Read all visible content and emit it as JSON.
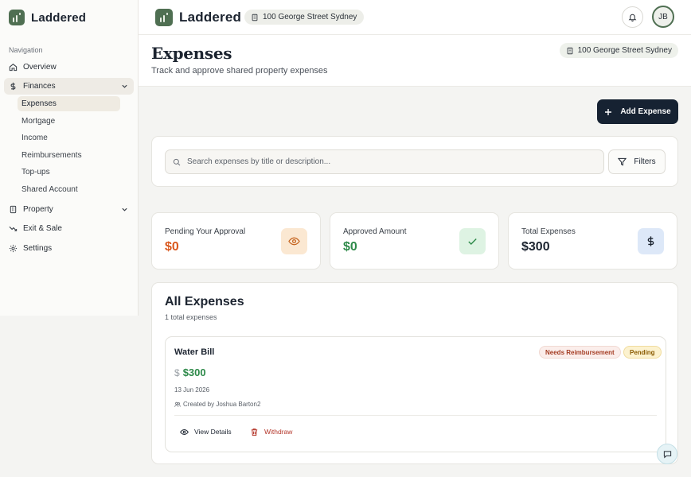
{
  "app": {
    "name": "Laddered"
  },
  "sidebar": {
    "caption": "Navigation",
    "items": [
      {
        "label": "Overview",
        "icon": "home-icon"
      },
      {
        "label": "Finances",
        "icon": "dollar-icon",
        "expanded": true
      },
      {
        "label": "Property",
        "icon": "building-icon"
      },
      {
        "label": "Exit & Sale",
        "icon": "trend-down-icon"
      },
      {
        "label": "Settings",
        "icon": "gear-icon"
      }
    ],
    "finance_subitems": [
      "Expenses",
      "Mortgage",
      "Income",
      "Reimbursements",
      "Top-ups",
      "Shared Account"
    ],
    "active_subitem": "Expenses"
  },
  "header": {
    "address": "100 George Street Sydney",
    "avatar_initials": "JB"
  },
  "page": {
    "title": "Expenses",
    "subtitle": "Track and approve shared property expenses",
    "address_badge": "100 George Street Sydney",
    "add_button": "Add Expense"
  },
  "search": {
    "placeholder": "Search expenses by title or description...",
    "filters_label": "Filters"
  },
  "stats": [
    {
      "label": "Pending Your Approval",
      "value": "$0",
      "color": "#d9581e",
      "icon": "eye-icon",
      "icon_bg": "#fbe8d2"
    },
    {
      "label": "Approved Amount",
      "value": "$0",
      "color": "#2e8a4a",
      "icon": "check-icon",
      "icon_bg": "#def3e3"
    },
    {
      "label": "Total Expenses",
      "value": "$300",
      "color": "#1c2430",
      "icon": "dollar-icon",
      "icon_bg": "#dde8f8"
    }
  ],
  "expenses": {
    "title": "All Expenses",
    "count_text": "1 total expenses",
    "items": [
      {
        "title": "Water Bill",
        "badges": [
          "Needs Reimbursement",
          "Pending"
        ],
        "amount": "$300",
        "date": "13 Jun 2026",
        "creator": "Created by Joshua Barton2",
        "actions": {
          "view": "View Details",
          "withdraw": "Withdraw"
        }
      }
    ]
  },
  "colors": {
    "brand_green": "#4f6f52",
    "navy_button": "#162232",
    "success": "#2e8a4a",
    "warning": "#d9581e",
    "danger": "#b4362a"
  }
}
